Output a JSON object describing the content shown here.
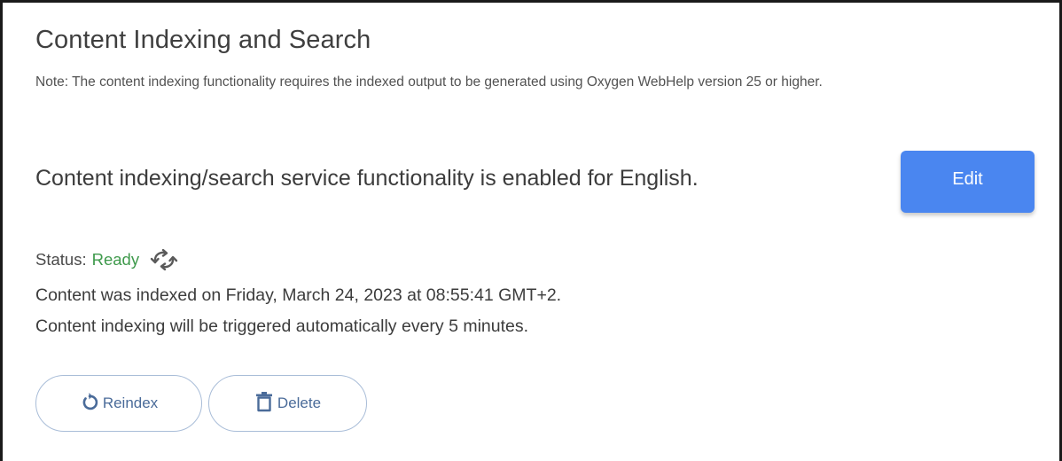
{
  "section": {
    "title": "Content Indexing and Search",
    "note": "Note: The content indexing functionality requires the indexed output to be generated using Oxygen WebHelp version 25 or higher.",
    "enabled_text": "Content indexing/search service functionality is enabled for English.",
    "edit_label": "Edit"
  },
  "status": {
    "label": "Status:",
    "value": "Ready",
    "refresh_icon": "refresh-icon",
    "indexed_on": "Content was indexed on Friday, March 24, 2023 at 08:55:41 GMT+2.",
    "schedule": "Content indexing will be triggered automatically every 5 minutes."
  },
  "actions": {
    "reindex_label": "Reindex",
    "reindex_icon": "reindex-icon",
    "delete_label": "Delete",
    "delete_icon": "trash-icon"
  },
  "colors": {
    "accent": "#4a86f0",
    "status_ready": "#3f9a4c",
    "outline_border": "#a9bdd8",
    "outline_text": "#4a6b99"
  }
}
